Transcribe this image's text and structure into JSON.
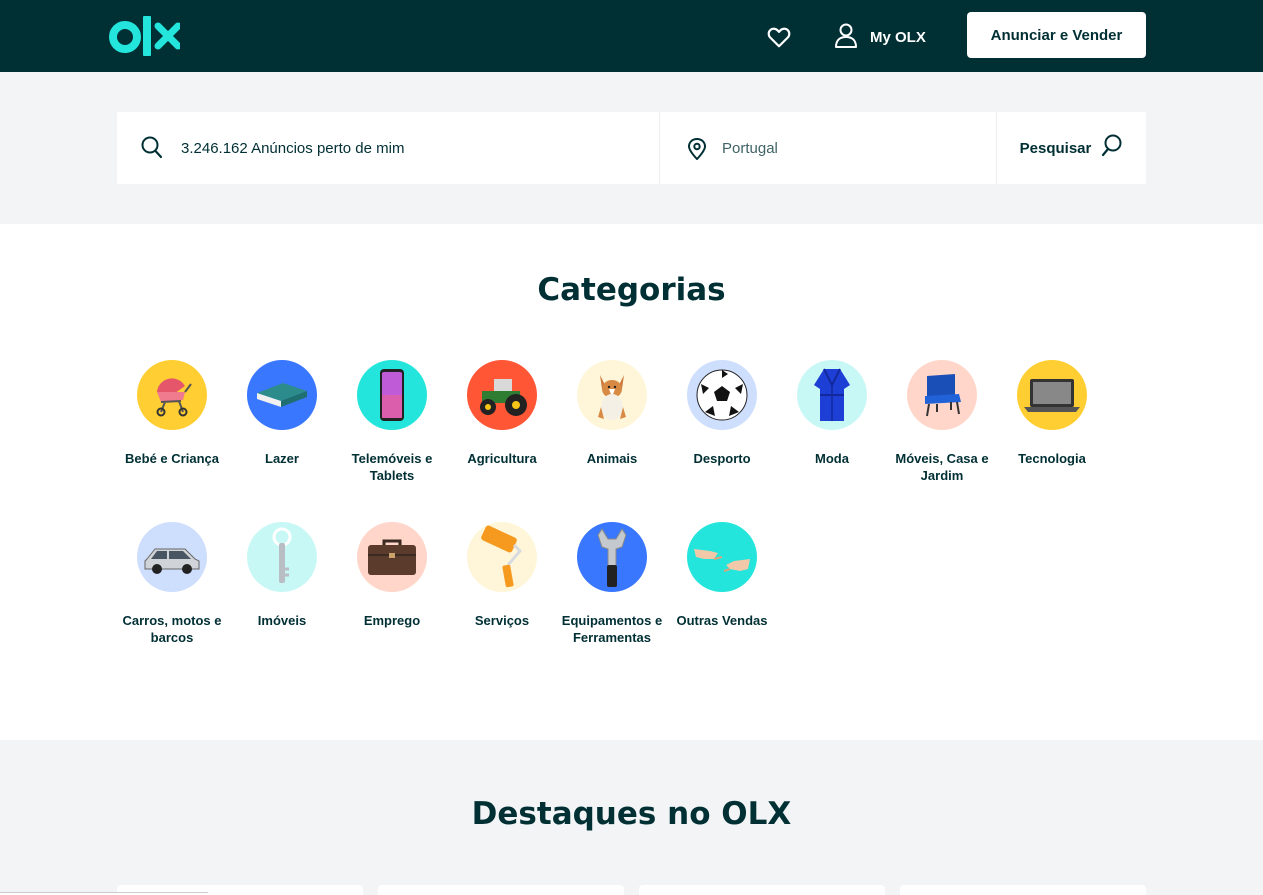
{
  "header": {
    "logo_text": "OLX",
    "my_olx_label": "My OLX",
    "sell_button_label": "Anunciar e Vender"
  },
  "search": {
    "query_value": "3.246.162 Anúncios perto de mim",
    "location_value": "Portugal",
    "search_button_label": "Pesquisar"
  },
  "categories": {
    "title": "Categorias",
    "items": [
      {
        "label": "Bebé e Criança",
        "icon": "baby-carriage-icon",
        "bg": "#ffce32"
      },
      {
        "label": "Lazer",
        "icon": "book-icon",
        "bg": "#3a77ff"
      },
      {
        "label": "Telemóveis e Tablets",
        "icon": "smartphone-icon",
        "bg": "#23e5db"
      },
      {
        "label": "Agricultura",
        "icon": "tractor-icon",
        "bg": "#ff5636"
      },
      {
        "label": "Animais",
        "icon": "dog-icon",
        "bg": "#fff6d9"
      },
      {
        "label": "Desporto",
        "icon": "soccer-ball-icon",
        "bg": "#cedefd"
      },
      {
        "label": "Moda",
        "icon": "robe-icon",
        "bg": "#c8f8f6"
      },
      {
        "label": "Móveis, Casa e Jardim",
        "icon": "armchair-icon",
        "bg": "#ffd6c9"
      },
      {
        "label": "Tecnologia",
        "icon": "laptop-icon",
        "bg": "#ffce32"
      },
      {
        "label": "Carros, motos e barcos",
        "icon": "car-icon",
        "bg": "#cedefd"
      },
      {
        "label": "Imóveis",
        "icon": "key-icon",
        "bg": "#c8f8f6"
      },
      {
        "label": "Emprego",
        "icon": "briefcase-icon",
        "bg": "#ffd6c9"
      },
      {
        "label": "Serviços",
        "icon": "paint-roller-icon",
        "bg": "#fff6d9"
      },
      {
        "label": "Equipamentos e Ferramentas",
        "icon": "wrench-icon",
        "bg": "#3a77ff"
      },
      {
        "label": "Outras Vendas",
        "icon": "handshake-icon",
        "bg": "#23e5db"
      }
    ]
  },
  "highlights": {
    "title": "Destaques no OLX"
  },
  "colors": {
    "brand_dark": "#002f34",
    "brand_teal": "#23e5db",
    "page_bg": "#f2f4f5"
  }
}
